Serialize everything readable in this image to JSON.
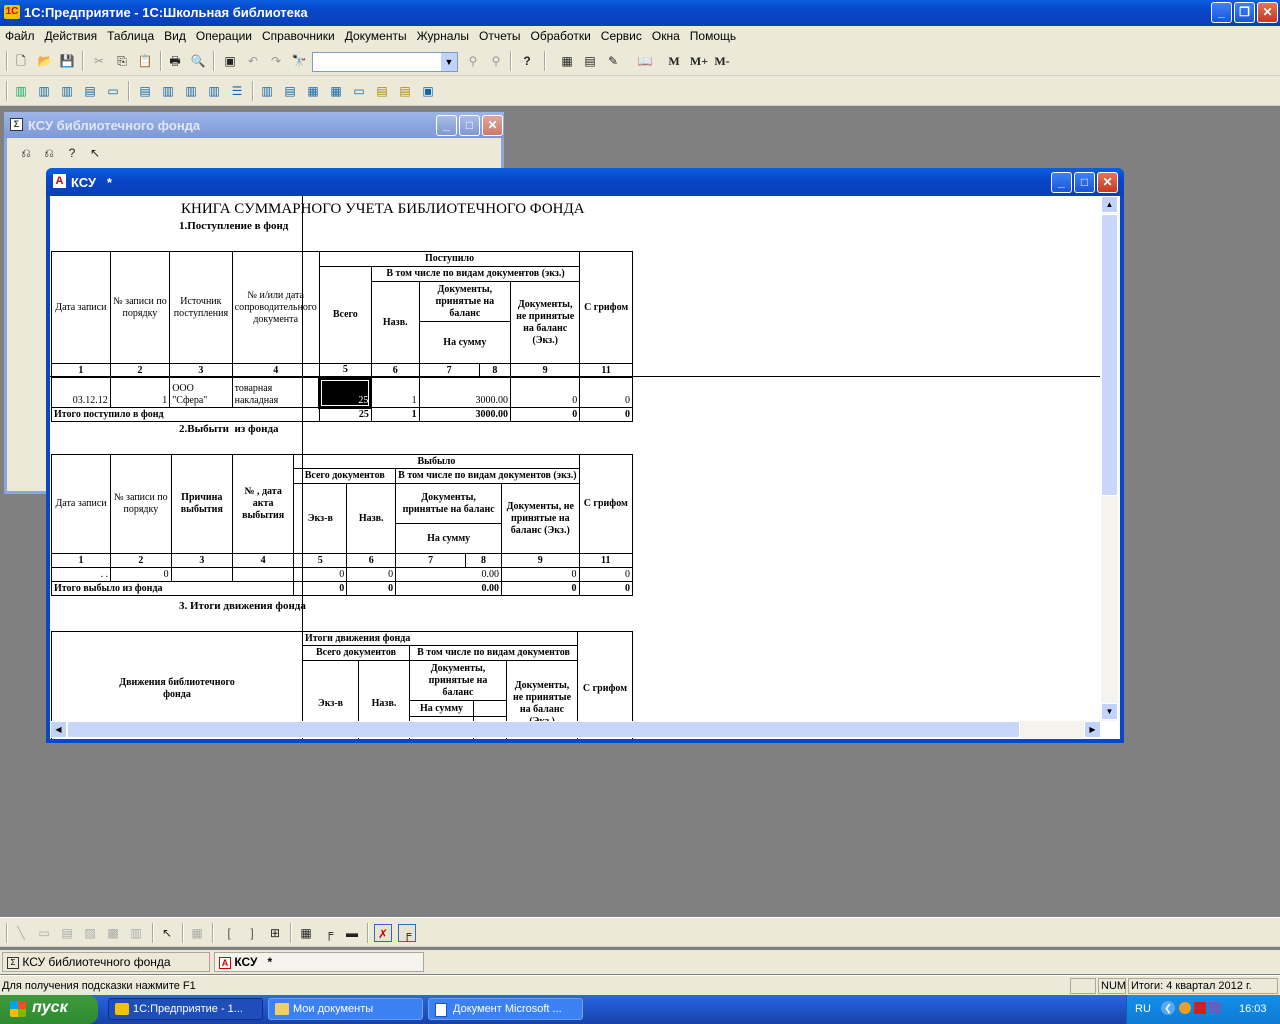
{
  "app": {
    "title": "1С:Предприятие - 1С:Школьная библиотека"
  },
  "menu": [
    "Файл",
    "Действия",
    "Таблица",
    "Вид",
    "Операции",
    "Справочники",
    "Документы",
    "Журналы",
    "Отчеты",
    "Обработки",
    "Сервис",
    "Окна",
    "Помощь"
  ],
  "toolbar": {
    "m": "M",
    "mplus": "M+",
    "mminus": "M-",
    "search_value": ""
  },
  "win1": {
    "title": "КСУ библиотечного фонда"
  },
  "win2": {
    "title": "КСУ   *"
  },
  "report": {
    "title": "КНИГА СУММАРНОГО УЧЕТА БИБЛИОТЕЧНОГО ФОНДА",
    "s1": {
      "title": "1.Поступление в фонд",
      "h_date": "Дата записи",
      "h_num": "№ записи по порядку",
      "h_src": "Источник поступления",
      "h_doc": "№ и/или дата сопроводительного документа",
      "h_recv": "Поступило",
      "h_incl": "В том числе по видам документов (экз.)",
      "h_total": "Всего",
      "h_naz": "Назв.",
      "h_bal": "Документы, принятые на баланс",
      "h_sum": "На сумму",
      "h_nbal": "Документы, не принятые на баланс (Экз.)",
      "h_grif": "С грифом",
      "cols": [
        "1",
        "2",
        "3",
        "4",
        "5",
        "6",
        "7",
        "8",
        "9",
        "11"
      ],
      "row": {
        "date": "03.12.12",
        "num": "1",
        "src": "ООО \"Сфера\"",
        "doc": "товарная накладная",
        "total": "25",
        "naz": "1",
        "sum": "3000.00",
        "nbal": "0",
        "grif": "0"
      },
      "itog": {
        "label": "Итого поступило в фонд",
        "total": "25",
        "naz": "1",
        "sum": "3000.00",
        "nbal": "0",
        "grif": "0"
      }
    },
    "s2": {
      "title": "2.Выбыти  из фонда",
      "h_date": "Дата записи",
      "h_num": "№ записи по порядку",
      "h_reason": "Причина выбытия",
      "h_act": "№ , дата акта выбытия",
      "h_out": "Выбыло",
      "h_alldoc": "Всего документов",
      "h_incl": "В том числе по видам документов (экз.)",
      "h_ex": "Экз-в",
      "h_naz": "Назв.",
      "h_bal": "Документы, принятые на баланс",
      "h_sum": "На сумму",
      "h_nbal": "Документы, не принятые на баланс (Экз.)",
      "h_grif": "С грифом",
      "cols": [
        "1",
        "2",
        "3",
        "4",
        "5",
        "6",
        "7",
        "8",
        "9",
        "11"
      ],
      "row": {
        "date": ". .",
        "num": "0",
        "ex": "0",
        "naz": "0",
        "sum": "0.00",
        "nbal": "0",
        "grif": "0"
      },
      "itog": {
        "label": "Итого выбыло из фонда",
        "ex": "0",
        "naz": "0",
        "sum": "0.00",
        "nbal": "0",
        "grif": "0"
      }
    },
    "s3": {
      "title": "3. Итоги движения фонда",
      "h_move": "Движения библиотечного фонда",
      "h_itog": "Итоги движения фонда",
      "h_alldoc": "Всего документов",
      "h_incl": "В том числе по видам документов",
      "h_ex": "Экз-в",
      "h_naz": "Назв.",
      "h_bal": "Документы, принятые на баланс",
      "h_sum": "На сумму",
      "h_nbal": "Документы, не принятые на баланс (Экз.)",
      "h_grif": "С грифом"
    }
  },
  "tabs": [
    "КСУ библиотечного фонда",
    "КСУ   *"
  ],
  "status": {
    "hint": "Для получения подсказки нажмите F1",
    "num": "NUM",
    "itogi": "Итоги: 4 квартал 2012 г."
  },
  "taskbar": {
    "start": "пуск",
    "items": [
      "1С:Предприятие - 1...",
      "Мои документы",
      "Документ Microsoft ..."
    ],
    "lang": "RU",
    "clock": "16:03"
  }
}
